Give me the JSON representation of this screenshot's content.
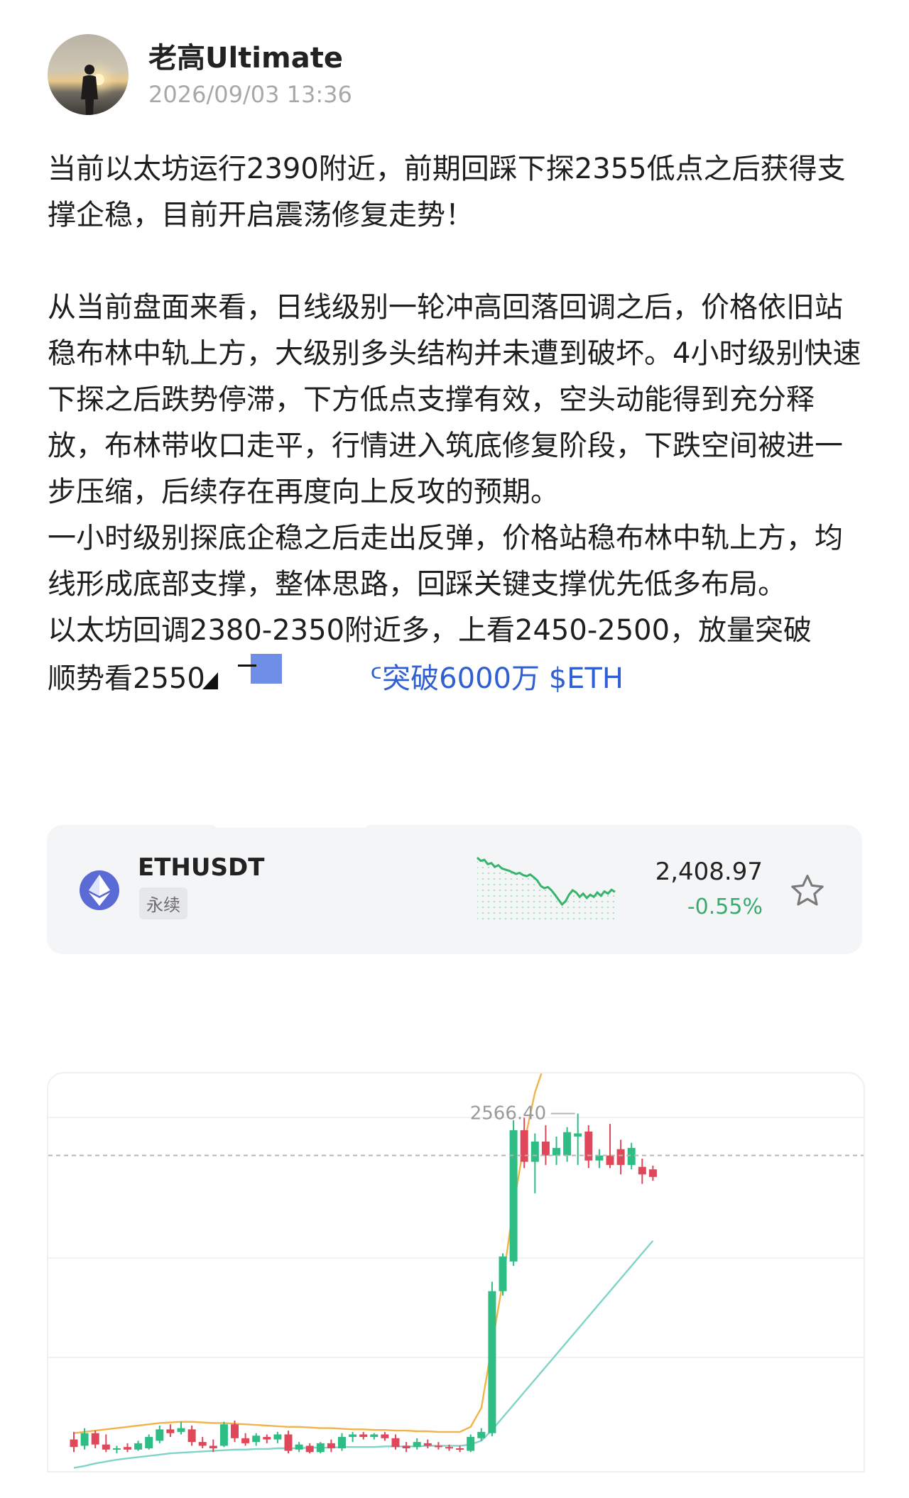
{
  "post": {
    "author": "老高Ultimate",
    "timestamp": "2026/09/03 13:36",
    "paragraphs": [
      "当前以太坊运行2390附近，前期回踩下探2355低点之后获得支撑企稳，目前开启震荡修复走势！",
      "从当前盘面来看，日线级别一轮冲高回落回调之后，价格依旧站稳布林中轨上方，大级别多头结构并未遭到破坏。4小时级别快速下探之后跌势停滞，下方低点支撑有效，空头动能得到充分释放，布林带收口走平，行情进入筑底修复阶段，下跌空间被进一步压缩，后续存在再度向上反攻的预期。",
      "一小时级别探底企稳之后走出反弹，价格站稳布林中轨上方，均线形成底部支撑，整体思路，回踩关键支撑优先低多布局。",
      "以太坊回调2380-2350附近多，上看2450-2500，放量突破"
    ],
    "last_line_start": "顺势看2550",
    "last_line_tail": "突破6000万",
    "ticker_link": "$ETH"
  },
  "coin_card": {
    "pair": "ETHUSDT",
    "tag": "永续",
    "price": "2,408.97",
    "change": "-0.55%",
    "change_color": "#3aaa6e",
    "icon": "ethereum-icon",
    "sparkline": [
      2472,
      2466,
      2468,
      2460,
      2462,
      2455,
      2458,
      2452,
      2450,
      2448,
      2445,
      2442,
      2444,
      2440,
      2438,
      2441,
      2436,
      2430,
      2420,
      2416,
      2418,
      2412,
      2404,
      2395,
      2386,
      2392,
      2404,
      2412,
      2408,
      2400,
      2406,
      2398,
      2404,
      2400,
      2408,
      2402,
      2410,
      2406,
      2413,
      2409
    ]
  },
  "chart_data": {
    "type": "candlestick",
    "label_high": "2566.40",
    "high": 2566.4,
    "colors": {
      "up": "#2ebd85",
      "down": "#e0475a",
      "boll_upper": "#f0b44a",
      "boll_middle": "#7fd4c8"
    },
    "candles": [
      {
        "o": 2050,
        "h": 2062,
        "l": 2030,
        "c": 2038
      },
      {
        "o": 2040,
        "h": 2068,
        "l": 2034,
        "c": 2060
      },
      {
        "o": 2060,
        "h": 2064,
        "l": 2036,
        "c": 2042
      },
      {
        "o": 2042,
        "h": 2058,
        "l": 2030,
        "c": 2034
      },
      {
        "o": 2034,
        "h": 2040,
        "l": 2028,
        "c": 2036
      },
      {
        "o": 2038,
        "h": 2044,
        "l": 2030,
        "c": 2034
      },
      {
        "o": 2034,
        "h": 2048,
        "l": 2032,
        "c": 2044
      },
      {
        "o": 2036,
        "h": 2058,
        "l": 2034,
        "c": 2054
      },
      {
        "o": 2048,
        "h": 2072,
        "l": 2044,
        "c": 2066
      },
      {
        "o": 2066,
        "h": 2074,
        "l": 2054,
        "c": 2060
      },
      {
        "o": 2062,
        "h": 2078,
        "l": 2058,
        "c": 2068
      },
      {
        "o": 2066,
        "h": 2072,
        "l": 2040,
        "c": 2046
      },
      {
        "o": 2046,
        "h": 2054,
        "l": 2036,
        "c": 2040
      },
      {
        "o": 2040,
        "h": 2050,
        "l": 2030,
        "c": 2036
      },
      {
        "o": 2040,
        "h": 2078,
        "l": 2038,
        "c": 2074
      },
      {
        "o": 2074,
        "h": 2080,
        "l": 2046,
        "c": 2052
      },
      {
        "o": 2052,
        "h": 2060,
        "l": 2040,
        "c": 2044
      },
      {
        "o": 2046,
        "h": 2060,
        "l": 2040,
        "c": 2056
      },
      {
        "o": 2054,
        "h": 2058,
        "l": 2044,
        "c": 2050
      },
      {
        "o": 2050,
        "h": 2062,
        "l": 2044,
        "c": 2058
      },
      {
        "o": 2058,
        "h": 2064,
        "l": 2028,
        "c": 2032
      },
      {
        "o": 2034,
        "h": 2046,
        "l": 2030,
        "c": 2042
      },
      {
        "o": 2040,
        "h": 2044,
        "l": 2028,
        "c": 2030
      },
      {
        "o": 2030,
        "h": 2046,
        "l": 2028,
        "c": 2044
      },
      {
        "o": 2044,
        "h": 2050,
        "l": 2030,
        "c": 2036
      },
      {
        "o": 2036,
        "h": 2060,
        "l": 2032,
        "c": 2054
      },
      {
        "o": 2054,
        "h": 2062,
        "l": 2046,
        "c": 2058
      },
      {
        "o": 2058,
        "h": 2062,
        "l": 2050,
        "c": 2054
      },
      {
        "o": 2054,
        "h": 2060,
        "l": 2050,
        "c": 2058
      },
      {
        "o": 2058,
        "h": 2062,
        "l": 2048,
        "c": 2052
      },
      {
        "o": 2052,
        "h": 2058,
        "l": 2034,
        "c": 2038
      },
      {
        "o": 2040,
        "h": 2046,
        "l": 2030,
        "c": 2036
      },
      {
        "o": 2038,
        "h": 2052,
        "l": 2034,
        "c": 2046
      },
      {
        "o": 2044,
        "h": 2050,
        "l": 2036,
        "c": 2040
      },
      {
        "o": 2040,
        "h": 2046,
        "l": 2034,
        "c": 2038
      },
      {
        "o": 2038,
        "h": 2042,
        "l": 2032,
        "c": 2036
      },
      {
        "o": 2036,
        "h": 2040,
        "l": 2030,
        "c": 2034
      },
      {
        "o": 2032,
        "h": 2058,
        "l": 2030,
        "c": 2054
      },
      {
        "o": 2052,
        "h": 2068,
        "l": 2048,
        "c": 2062
      },
      {
        "o": 2060,
        "h": 2300,
        "l": 2055,
        "c": 2285
      },
      {
        "o": 2285,
        "h": 2345,
        "l": 2278,
        "c": 2340
      },
      {
        "o": 2332,
        "h": 2556,
        "l": 2325,
        "c": 2540
      },
      {
        "o": 2540,
        "h": 2560,
        "l": 2480,
        "c": 2490
      },
      {
        "o": 2490,
        "h": 2535,
        "l": 2440,
        "c": 2522
      },
      {
        "o": 2522,
        "h": 2548,
        "l": 2485,
        "c": 2500
      },
      {
        "o": 2500,
        "h": 2530,
        "l": 2485,
        "c": 2512
      },
      {
        "o": 2500,
        "h": 2545,
        "l": 2490,
        "c": 2537
      },
      {
        "o": 2530,
        "h": 2566.4,
        "l": 2485,
        "c": 2535
      },
      {
        "o": 2538,
        "h": 2548,
        "l": 2480,
        "c": 2492
      },
      {
        "o": 2492,
        "h": 2510,
        "l": 2480,
        "c": 2500
      },
      {
        "o": 2500,
        "h": 2550,
        "l": 2480,
        "c": 2485
      },
      {
        "o": 2510,
        "h": 2525,
        "l": 2470,
        "c": 2485
      },
      {
        "o": 2485,
        "h": 2520,
        "l": 2478,
        "c": 2512
      },
      {
        "o": 2482,
        "h": 2495,
        "l": 2455,
        "c": 2470
      },
      {
        "o": 2478,
        "h": 2484,
        "l": 2460,
        "c": 2466
      }
    ],
    "boll_upper": [
      2060,
      2062,
      2064,
      2066,
      2068,
      2070,
      2072,
      2074,
      2076,
      2077,
      2078,
      2078,
      2077,
      2076,
      2076,
      2075,
      2074,
      2073,
      2072,
      2071,
      2070,
      2070,
      2069,
      2068,
      2068,
      2067,
      2066,
      2066,
      2065,
      2065,
      2064,
      2064,
      2063,
      2063,
      2062,
      2062,
      2062,
      2070,
      2100,
      2200,
      2300,
      2420,
      2520,
      2600,
      2650,
      2700,
      2750,
      2780,
      2800,
      2820,
      2840,
      2860,
      2880,
      2900,
      2920
    ],
    "boll_middle": [
      2005,
      2008,
      2012,
      2015,
      2018,
      2020,
      2022,
      2024,
      2026,
      2028,
      2029,
      2030,
      2031,
      2032,
      2033,
      2034,
      2034,
      2035,
      2035,
      2036,
      2036,
      2036,
      2037,
      2037,
      2037,
      2038,
      2038,
      2038,
      2038,
      2039,
      2039,
      2039,
      2039,
      2040,
      2040,
      2040,
      2040,
      2042,
      2048,
      2065,
      2085,
      2105,
      2125,
      2145,
      2165,
      2185,
      2205,
      2225,
      2245,
      2265,
      2285,
      2305,
      2325,
      2345,
      2365
    ]
  }
}
